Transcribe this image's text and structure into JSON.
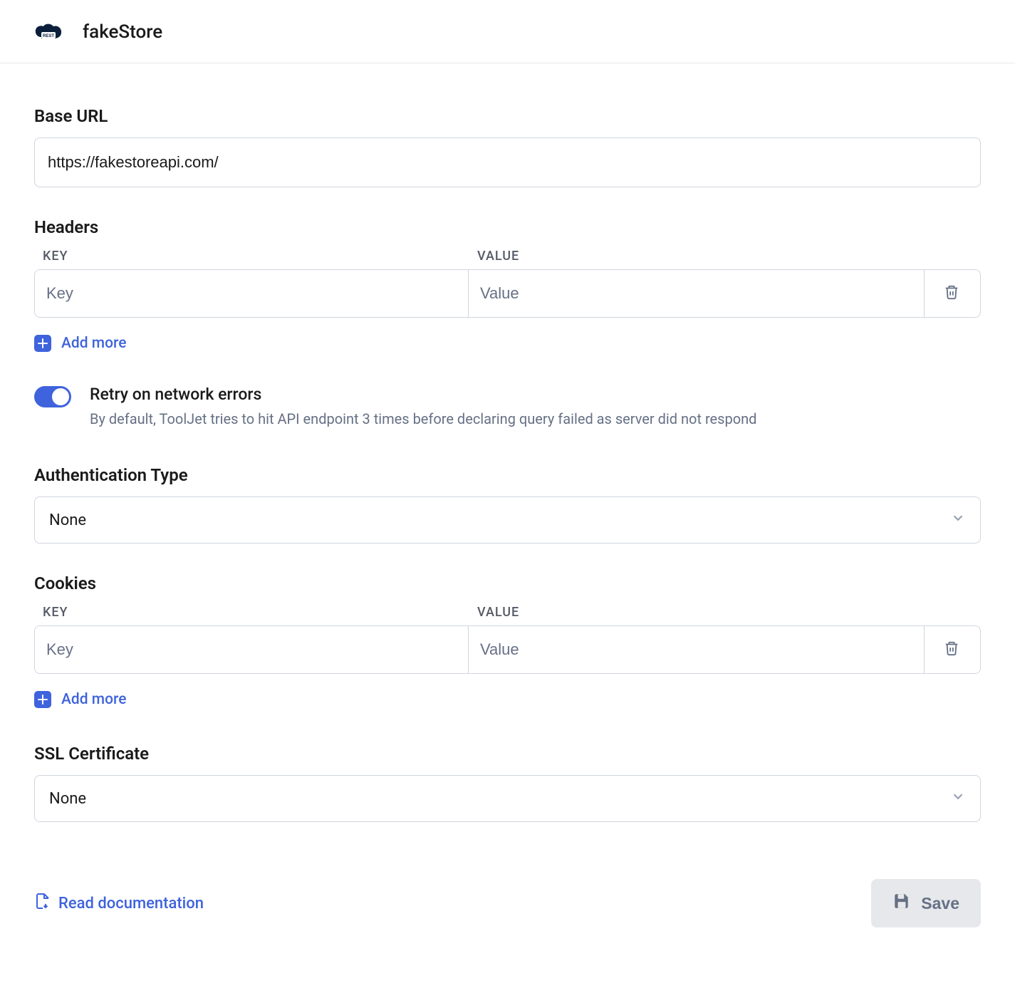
{
  "header": {
    "icon_label": "REST",
    "title": "fakeStore"
  },
  "base_url": {
    "label": "Base URL",
    "value": "https://fakestoreapi.com/"
  },
  "headers": {
    "label": "Headers",
    "key_col": "KEY",
    "value_col": "VALUE",
    "row": {
      "key_placeholder": "Key",
      "value_placeholder": "Value"
    },
    "add_more": "Add more"
  },
  "retry": {
    "enabled": true,
    "title": "Retry on network errors",
    "description": "By default, ToolJet tries to hit API endpoint 3 times before declaring query failed as server did not respond"
  },
  "auth_type": {
    "label": "Authentication Type",
    "value": "None"
  },
  "cookies": {
    "label": "Cookies",
    "key_col": "KEY",
    "value_col": "VALUE",
    "row": {
      "key_placeholder": "Key",
      "value_placeholder": "Value"
    },
    "add_more": "Add more"
  },
  "ssl": {
    "label": "SSL Certificate",
    "value": "None"
  },
  "footer": {
    "doc_link": "Read documentation",
    "save": "Save"
  }
}
